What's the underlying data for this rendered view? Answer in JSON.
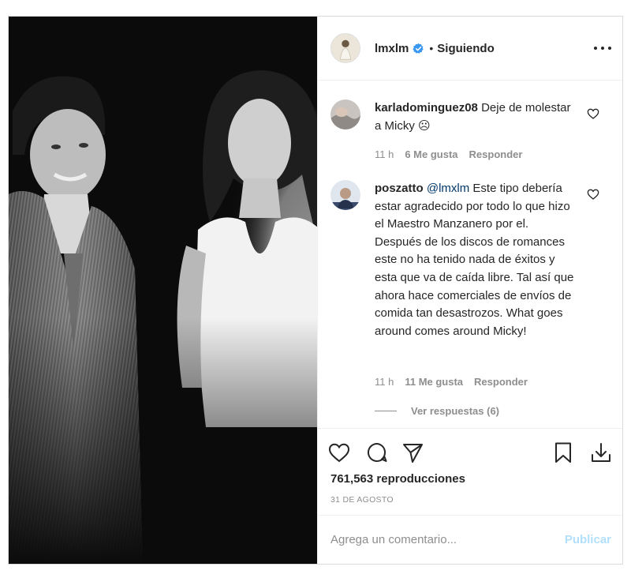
{
  "header": {
    "username": "lmxlm",
    "separator": "•",
    "follow_status": "Siguiendo"
  },
  "comments": [
    {
      "username": "karladominguez08",
      "text": "Deje de molestar a Micky ☹",
      "time": "11 h",
      "likes": "6 Me gusta",
      "reply": "Responder"
    },
    {
      "username": "poszatto",
      "mention": "@lmxlm",
      "text": "Este tipo debería estar agradecido por todo lo que hizo el Maestro Manzanero por el. Después de los discos de romances este no ha tenido nada de éxitos y esta que va de caída libre. Tal así que ahora hace comerciales de envíos de comida tan desastrozos. What goes around comes around Micky!",
      "time": "11 h",
      "likes": "11 Me gusta",
      "reply": "Responder",
      "view_replies": "Ver respuestas (6)"
    }
  ],
  "stats": {
    "views": "761,563 reproducciones",
    "date": "31 DE AGOSTO"
  },
  "composer": {
    "placeholder": "Agrega un comentario...",
    "publish_label": "Publicar"
  },
  "icons": {
    "like": "heart-icon",
    "comment": "comment-icon",
    "share": "send-icon",
    "save": "bookmark-icon",
    "download": "download-icon",
    "more": "more-options-icon",
    "verified": "verified-badge-icon"
  },
  "colors": {
    "verified": "#3897f0",
    "publish_disabled": "#b2dffc",
    "mention": "#00376b",
    "muted_text": "#8e8e8e"
  }
}
